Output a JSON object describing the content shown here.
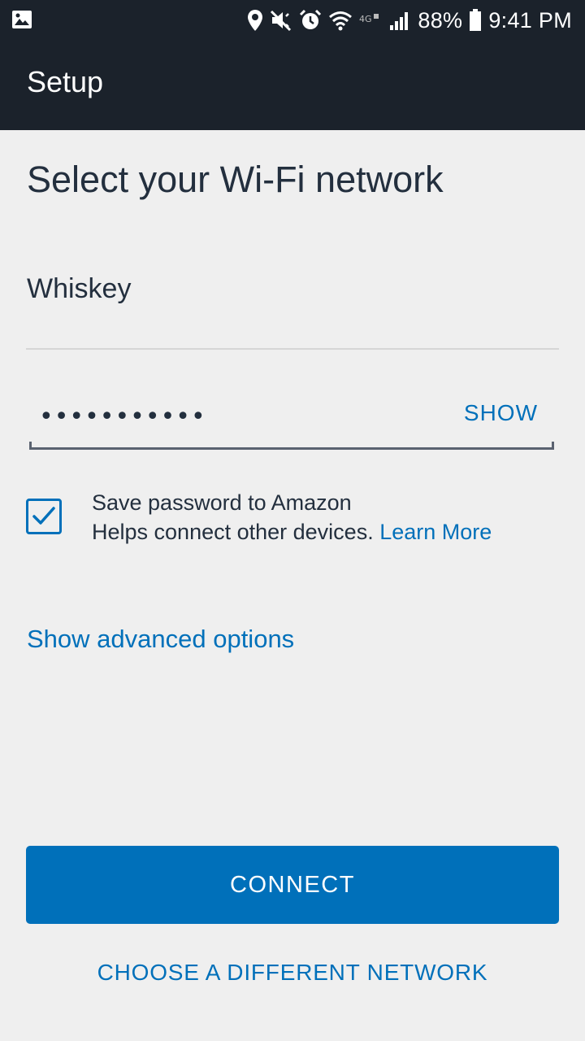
{
  "status_bar": {
    "battery": "88%",
    "time": "9:41 PM",
    "icons": [
      "image-icon",
      "location-icon",
      "mute-icon",
      "alarm-icon",
      "wifi-icon",
      "4g-icon",
      "signal-icon",
      "battery-icon"
    ]
  },
  "appbar": {
    "title": "Setup"
  },
  "main": {
    "heading": "Select your Wi-Fi network",
    "network_name": "Whiskey",
    "password": {
      "value": "•••••••••••",
      "show_label": "SHOW"
    },
    "save_password": {
      "checked": true,
      "title": "Save password to Amazon",
      "subtitle": "Helps connect other devices.",
      "link": "Learn More"
    },
    "advanced_link": "Show advanced options"
  },
  "actions": {
    "connect": "CONNECT",
    "different_network": "CHOOSE A DIFFERENT NETWORK"
  },
  "colors": {
    "bar": "#1b222b",
    "accent": "#0070ba",
    "background": "#efefef",
    "text": "#232f3e"
  }
}
